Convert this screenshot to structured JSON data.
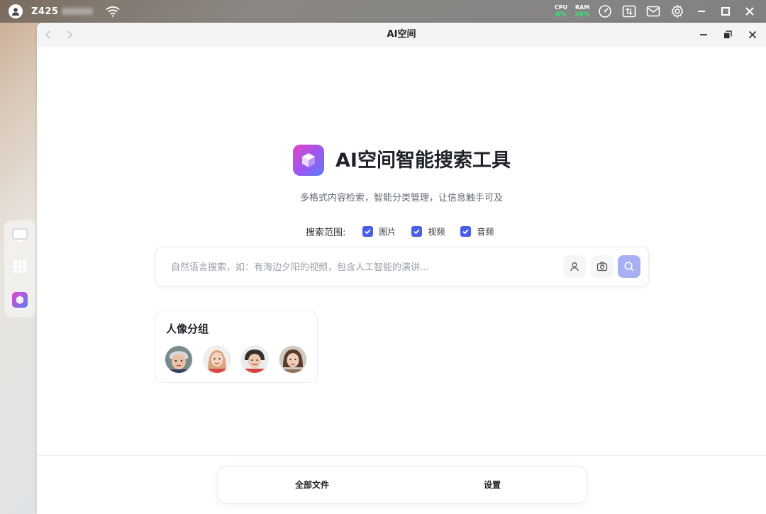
{
  "taskbar": {
    "device_name": "Z425",
    "cpu_label": "CPU",
    "cpu_value": "0%",
    "ram_label": "RAM",
    "ram_value": "38%"
  },
  "window": {
    "title": "AI空间"
  },
  "hero": {
    "title": "AI空间智能搜索工具",
    "subtitle": "多格式内容检索，智能分类管理，让信息触手可及"
  },
  "scope": {
    "label": "搜索范围:",
    "options": [
      {
        "label": "图片",
        "checked": true
      },
      {
        "label": "视频",
        "checked": true
      },
      {
        "label": "音频",
        "checked": true
      }
    ]
  },
  "search": {
    "value": "",
    "placeholder": "自然语言搜索，如：有海边夕阳的视频，包含人工智能的演讲..."
  },
  "people_group": {
    "title": "人像分组"
  },
  "bottom_bar": {
    "all_files": "全部文件",
    "settings": "设置"
  },
  "colors": {
    "accent": "#4a5ee8",
    "search_primary": "#a8b0f4",
    "stat_green": "#3ee07a"
  }
}
